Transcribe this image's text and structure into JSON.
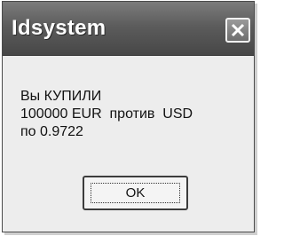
{
  "window": {
    "title": "Idsystem"
  },
  "titlebar": {
    "close_icon": "close-x-icon"
  },
  "message": {
    "line1": "Вы КУПИЛИ",
    "line2": "100000 EUR  против  USD",
    "line3": "по 0.9722"
  },
  "buttons": {
    "ok_label": "OK"
  }
}
